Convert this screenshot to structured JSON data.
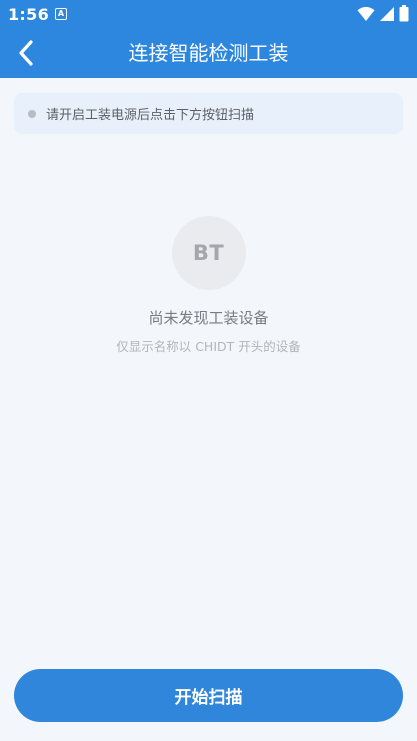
{
  "status_bar": {
    "time": "1:56",
    "notification_icon_label": "A",
    "icons": [
      "wifi-icon",
      "signal-icon",
      "battery-icon"
    ]
  },
  "app_bar": {
    "title": "连接智能检测工装",
    "back_icon": "chevron-left-icon"
  },
  "hint": {
    "text": "请开启工装电源后点击下方按钮扫描"
  },
  "empty_state": {
    "badge": "BT",
    "title": "尚未发现工装设备",
    "subtitle": "仅显示名称以 CHIDT 开头的设备"
  },
  "actions": {
    "start_scan_label": "开始扫描"
  },
  "colors": {
    "primary": "#2d87de",
    "background": "#f3f6fb",
    "hint_background": "#e8f1fb"
  }
}
